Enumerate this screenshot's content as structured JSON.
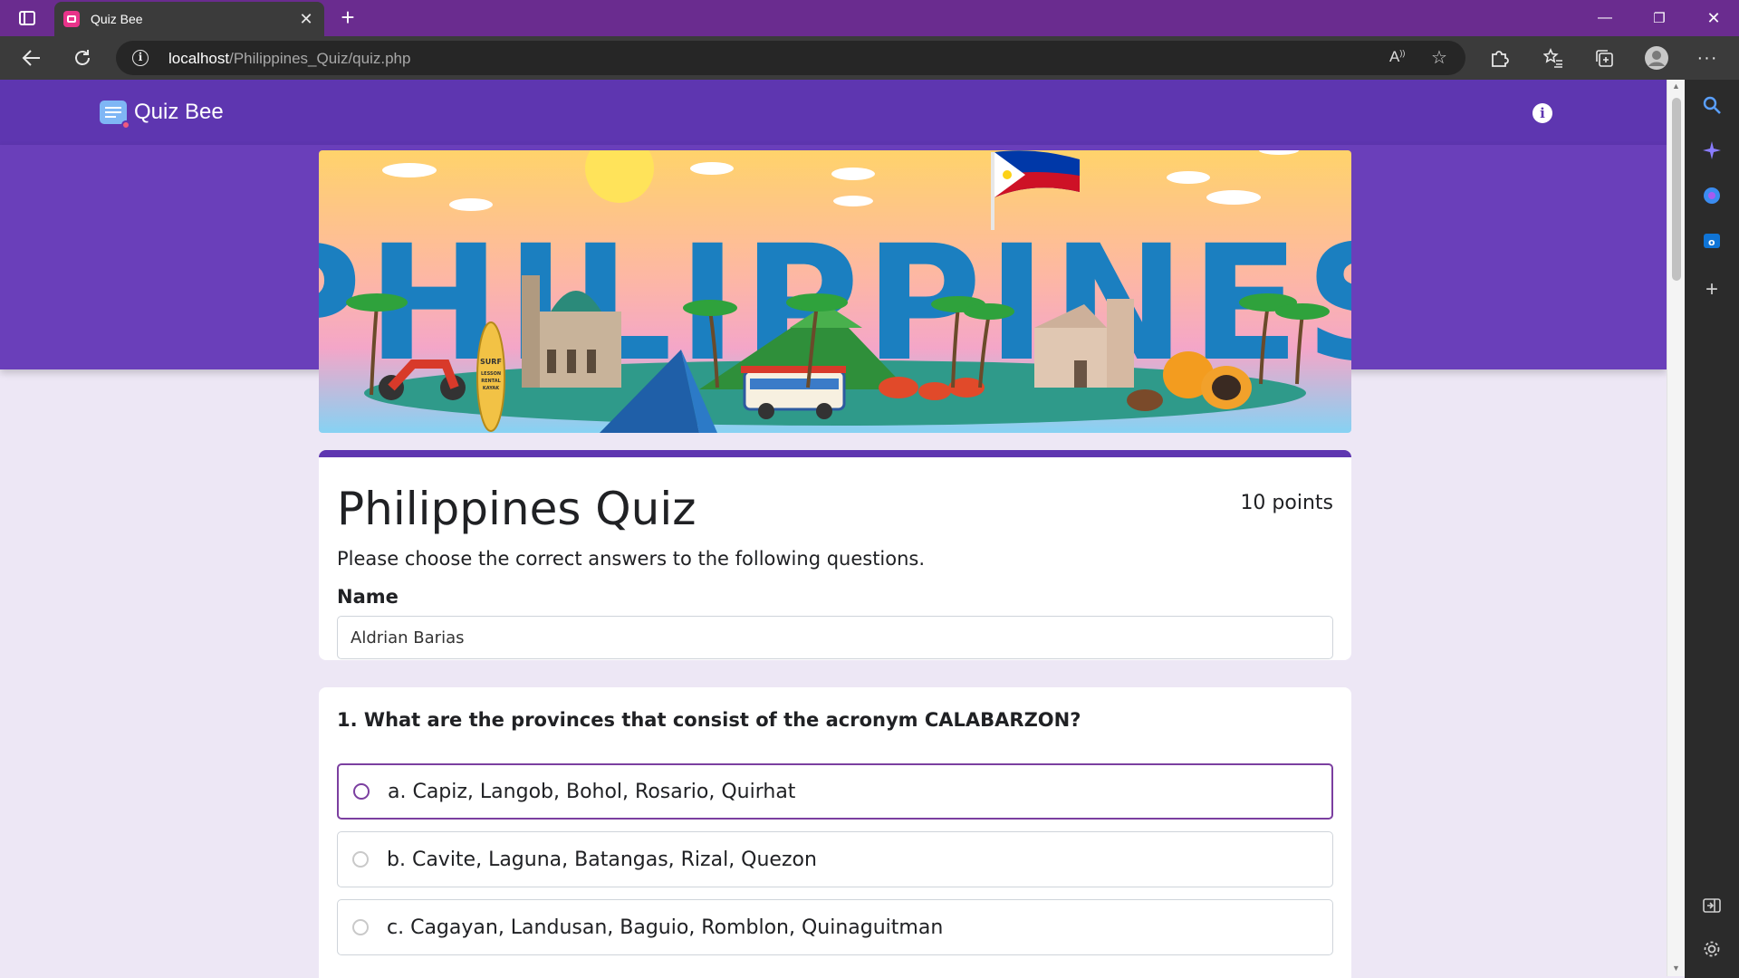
{
  "browser": {
    "tab_title": "Quiz Bee",
    "tab_close": "✕",
    "new_tab": "+",
    "url_host": "localhost",
    "url_path": "/Philippines_Quiz/quiz.php",
    "win_minimize": "—",
    "win_restore": "❐",
    "win_close": "✕"
  },
  "nav": {
    "brand": "Quiz Bee",
    "info": "i"
  },
  "banner": {
    "text": "PHILIPPINES",
    "surf_sign": [
      "SURF",
      "LESSON",
      "RENTAL",
      "KAYAK"
    ]
  },
  "quiz": {
    "title": "Philippines Quiz",
    "points": "10 points",
    "description": "Please choose the correct answers to the following questions.",
    "name_label": "Name",
    "name_value": "Aldrian Barias"
  },
  "question1": {
    "text": "1. What are the provinces that consist of the acronym CALABARZON?",
    "options": [
      "a. Capiz, Langob, Bohol, Rosario, Quirhat",
      "b. Cavite, Laguna, Batangas, Rizal, Quezon",
      "c. Cagayan, Landusan, Baguio, Romblon, Quinaguitman"
    ]
  },
  "colors": {
    "tabbar": "#6a2c8f",
    "nav": "#5e36b0",
    "accent": "#7b3fa0"
  }
}
